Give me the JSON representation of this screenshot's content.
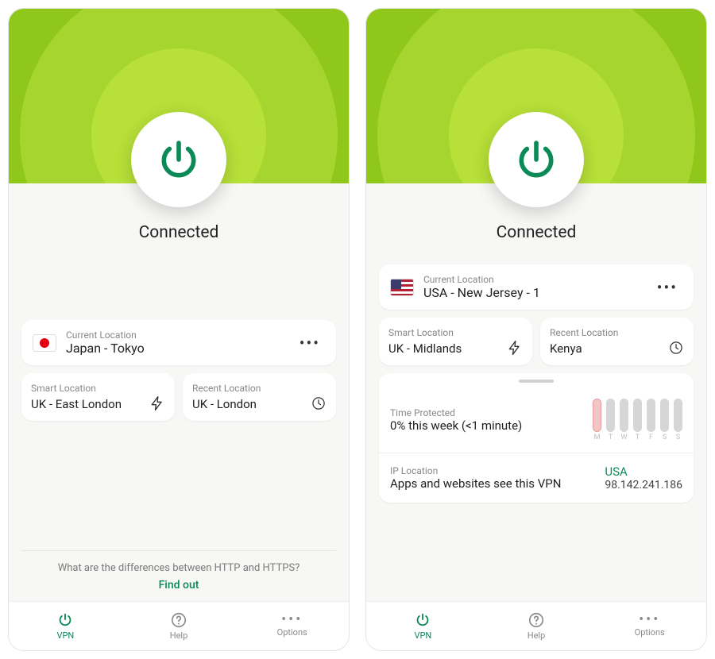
{
  "colors": {
    "accent": "#0a8a57",
    "heroGreen": "#8fc71a"
  },
  "left": {
    "status": "Connected",
    "spacer_height": 70,
    "current": {
      "label": "Current Location",
      "value": "Japan - Tokyo",
      "flag": "jp"
    },
    "smart": {
      "label": "Smart Location",
      "value": "UK - East London"
    },
    "recent": {
      "label": "Recent Location",
      "value": "UK - London"
    },
    "tip": {
      "question": "What are the differences between HTTP and HTTPS?",
      "link": "Find out"
    },
    "tabs": {
      "vpn": "VPN",
      "help": "Help",
      "options": "Options"
    }
  },
  "right": {
    "status": "Connected",
    "spacer_height": 0,
    "current": {
      "label": "Current Location",
      "value": "USA - New Jersey - 1",
      "flag": "us"
    },
    "smart": {
      "label": "Smart Location",
      "value": "UK - Midlands"
    },
    "recent": {
      "label": "Recent Location",
      "value": "Kenya"
    },
    "time_protected": {
      "label": "Time Protected",
      "value": "0% this week (<1 minute)",
      "days": [
        "M",
        "T",
        "W",
        "T",
        "F",
        "S",
        "S"
      ],
      "today_index": 0
    },
    "ip": {
      "label": "IP Location",
      "desc": "Apps and websites see this VPN",
      "country": "USA",
      "address": "98.142.241.186"
    },
    "tabs": {
      "vpn": "VPN",
      "help": "Help",
      "options": "Options"
    }
  },
  "chart_data": {
    "type": "bar",
    "title": "Time Protected",
    "categories": [
      "M",
      "T",
      "W",
      "T",
      "F",
      "S",
      "S"
    ],
    "values": [
      0,
      0,
      0,
      0,
      0,
      0,
      0
    ],
    "xlabel": "",
    "ylabel": "Time protected",
    "ylim": [
      0,
      100
    ],
    "annotation": "0% this week (<1 minute)"
  }
}
